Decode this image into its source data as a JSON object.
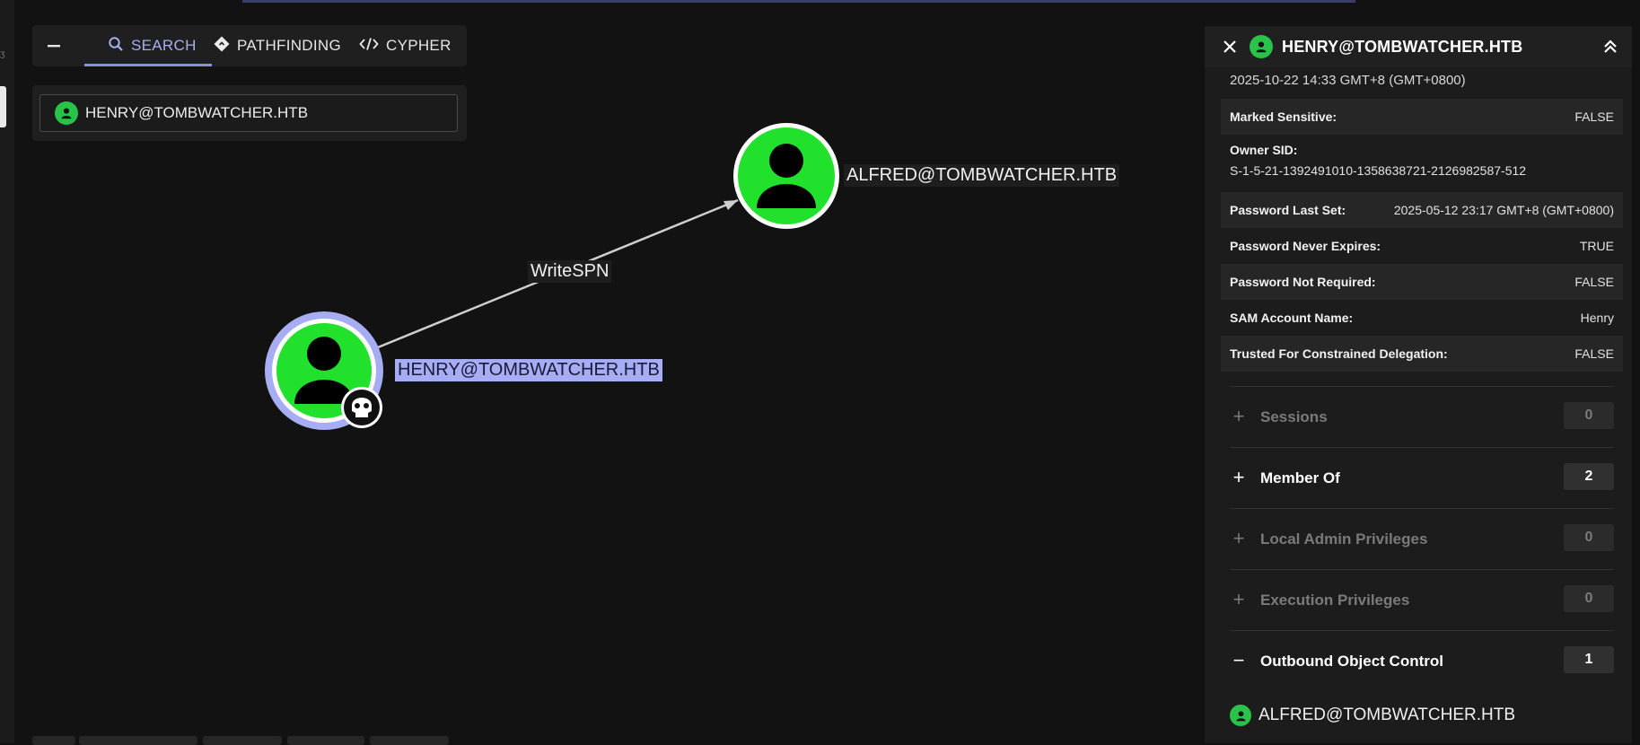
{
  "tabs": {
    "collapse_icon": "minus-icon",
    "items": [
      {
        "label": "SEARCH",
        "icon": "search-icon",
        "active": true
      },
      {
        "label": "PATHFINDING",
        "icon": "diamond-arrow-icon",
        "active": false
      },
      {
        "label": "CYPHER",
        "icon": "code-icon",
        "active": false
      }
    ]
  },
  "search": {
    "value": "HENRY@TOMBWATCHER.HTB"
  },
  "graph": {
    "nodes": [
      {
        "label": "HENRY@TOMBWATCHER.HTB",
        "type": "user",
        "selected": true,
        "badge": "skull-icon"
      },
      {
        "label": "ALFRED@TOMBWATCHER.HTB",
        "type": "user",
        "selected": false
      }
    ],
    "edge": {
      "label": "WriteSPN"
    }
  },
  "panel": {
    "title": "HENRY@TOMBWATCHER.HTB",
    "partial_top": "2025-10-22 14:33 GMT+8 (GMT+0800)",
    "properties": [
      {
        "key": "Marked Sensitive:",
        "value": "FALSE"
      },
      {
        "key": "Owner SID:",
        "value": "S-1-5-21-1392491010-1358638721-2126982587-512"
      },
      {
        "key": "Password Last Set:",
        "value": "2025-05-12 23:17 GMT+8 (GMT+0800)"
      },
      {
        "key": "Password Never Expires:",
        "value": "TRUE"
      },
      {
        "key": "Password Not Required:",
        "value": "FALSE"
      },
      {
        "key": "SAM Account Name:",
        "value": "Henry"
      },
      {
        "key": "Trusted For Constrained Delegation:",
        "value": "FALSE"
      }
    ],
    "sections": [
      {
        "name": "Sessions",
        "count": "0",
        "sign": "+"
      },
      {
        "name": "Member Of",
        "count": "2",
        "sign": "+"
      },
      {
        "name": "Local Admin Privileges",
        "count": "0",
        "sign": "+"
      },
      {
        "name": "Execution Privileges",
        "count": "0",
        "sign": "+"
      },
      {
        "name": "Outbound Object Control",
        "count": "1",
        "sign": "−"
      }
    ],
    "outbound_items": [
      "ALFRED@TOMBWATCHER.HTB"
    ]
  },
  "colors": {
    "user_node": "#22e12c",
    "selected_ring": "#a7adf2",
    "accent": "#8a90e0",
    "background": "#121212"
  }
}
